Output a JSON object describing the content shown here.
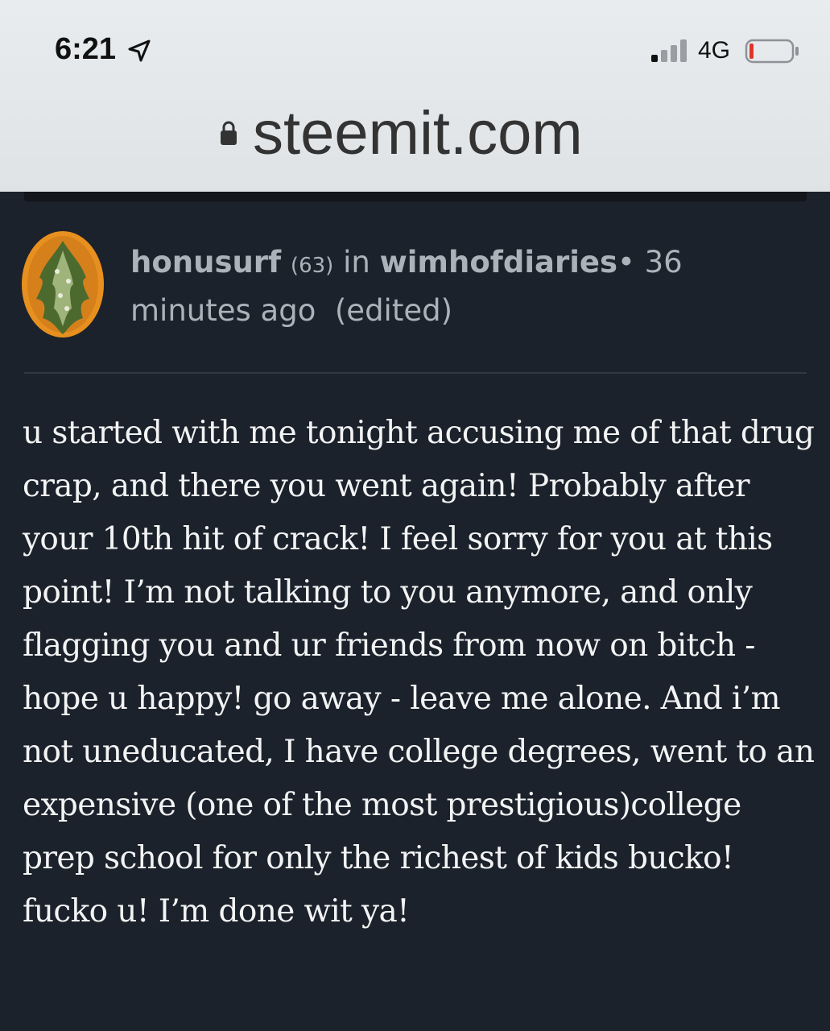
{
  "status_bar": {
    "time": "6:21",
    "network": "4G",
    "icons": [
      "location-arrow-icon",
      "signal-bars-icon",
      "battery-low-icon"
    ]
  },
  "browser": {
    "url": "steemit.com",
    "icons": [
      "lock-icon"
    ]
  },
  "comment": {
    "author": "honusurf",
    "reputation": "(63)",
    "in_label": "in",
    "community": "wimhofdiaries",
    "separator": "•",
    "time_ago": "36 minutes ago",
    "edited_label": "(edited)",
    "body": "u started with me tonight accusing me of that drug crap, and there you went again! Probably after your 10th hit of crack! I feel sorry for you at this point! I’m not talking to you anymore, and only flagging you and ur friends from now on bitch - hope u happy! go away - leave me alone. And i’m not uneducated, I have college degrees, went to an expensive (one of the most prestigious)college prep school for only the richest of kids bucko! fucko u! I’m done wit ya!"
  },
  "colors": {
    "page_background": "#1c222b",
    "browser_bar": "#e5e8ea",
    "meta_text": "#aab3ba",
    "body_text": "#f2f3f4",
    "battery_level": "#e0352b"
  },
  "battery_level": 0.1
}
